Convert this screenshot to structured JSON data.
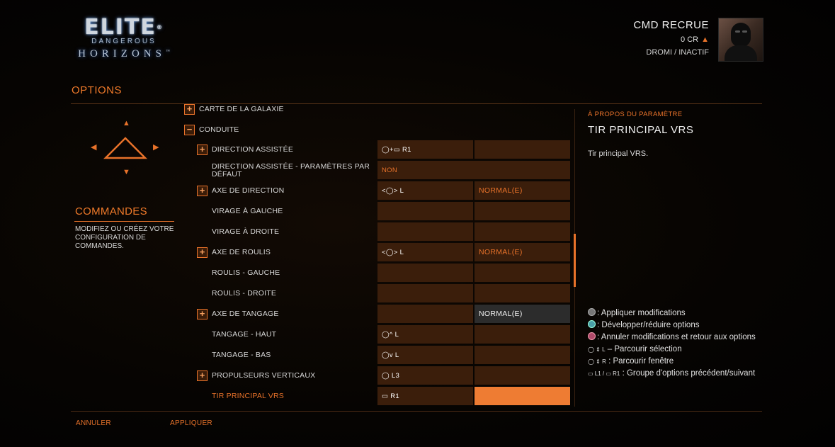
{
  "logo": {
    "line1": "ELITE",
    "line2": "DANGEROUS",
    "line3": "HORIZONS",
    "reg": "®",
    "tm": "™"
  },
  "commander": {
    "name": "CMD RECRUE",
    "credits": "0 CR",
    "location": "DROMI / INACTIF"
  },
  "header": {
    "title": "OPTIONS"
  },
  "left_panel": {
    "category_title": "COMMANDES",
    "category_desc": "MODIFIEZ OU CRÉEZ VOTRE CONFIGURATION DE COMMANDES."
  },
  "list": {
    "partial_top": "CARTE DE LA GALAXIE",
    "group": "CONDUITE",
    "rows": [
      {
        "label": "DIRECTION ASSISTÉE",
        "primary": "◯+▭ R1",
        "secondary": ""
      },
      {
        "label": "DIRECTION ASSISTÉE - PARAMÈTRES PAR DÉFAUT",
        "primary": "NON",
        "secondary": ""
      },
      {
        "label": "AXE DE DIRECTION",
        "primary": "<◯> L",
        "secondary": "NORMAL(E)"
      },
      {
        "label": "VIRAGE À GAUCHE",
        "primary": "",
        "secondary": ""
      },
      {
        "label": "VIRAGE À DROITE",
        "primary": "",
        "secondary": ""
      },
      {
        "label": "AXE DE ROULIS",
        "primary": "<◯> L",
        "secondary": "NORMAL(E)"
      },
      {
        "label": "ROULIS - GAUCHE",
        "primary": "",
        "secondary": ""
      },
      {
        "label": "ROULIS - DROITE",
        "primary": "",
        "secondary": ""
      },
      {
        "label": "AXE DE TANGAGE",
        "primary": "",
        "secondary": "NORMAL(E)"
      },
      {
        "label": "TANGAGE - HAUT",
        "primary": "◯^ L",
        "secondary": ""
      },
      {
        "label": "TANGAGE - BAS",
        "primary": "◯v L",
        "secondary": ""
      },
      {
        "label": "PROPULSEURS VERTICAUX",
        "primary": "◯ L3",
        "secondary": ""
      },
      {
        "label": "TIR PRINCIPAL VRS",
        "primary": "▭ R1",
        "secondary": ""
      }
    ]
  },
  "about": {
    "header": "À PROPOS DU PARAMÈTRE",
    "title": "TIR PRINCIPAL VRS",
    "description": "Tir principal VRS."
  },
  "help": {
    "apply": ": Appliquer modifications",
    "expand": ": Développer/réduire options",
    "cancel": ": Annuler modifications et retour aux options",
    "browse_sel_btn": "◯ ⇕ L",
    "browse_sel": "– Parcourir sélection",
    "browse_win_btn": "◯ ⇕ R",
    "browse_win": ": Parcourir fenêtre",
    "group_btn": "▭ L1 / ▭ R1",
    "group": ": Groupe d'options précédent/suivant"
  },
  "footer": {
    "cancel": "ANNULER",
    "apply": "APPLIQUER"
  },
  "colors": {
    "accent": "#e8722a",
    "cell": "#3b1e0b",
    "selected": "#ee7c33"
  },
  "icons": [
    "dpad-up-icon",
    "dpad-down-icon",
    "dpad-left-icon",
    "dpad-right-icon",
    "rank-icon",
    "expand-icon",
    "collapse-icon",
    "circle-button-icon",
    "triangle-button-icon"
  ]
}
